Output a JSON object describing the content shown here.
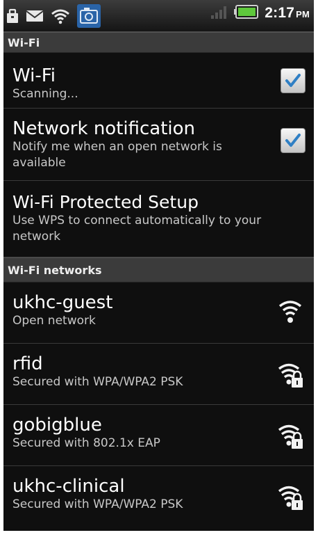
{
  "status_bar": {
    "time": "2:17",
    "ampm": "PM",
    "icons": [
      "briefcase-icon",
      "mail-icon",
      "wifi-signal-icon",
      "camera-icon",
      "cell-signal-icon",
      "battery-icon"
    ]
  },
  "wifi_section": {
    "header": "Wi-Fi",
    "wifi_toggle": {
      "title": "Wi-Fi",
      "subtitle": "Scanning...",
      "checked": true
    },
    "network_notification": {
      "title": "Network notification",
      "subtitle": "Notify me when an open network is available",
      "checked": true
    },
    "wps": {
      "title": "Wi-Fi Protected Setup",
      "subtitle": "Use WPS to connect automatically to your network"
    }
  },
  "networks_section": {
    "header": "Wi-Fi networks",
    "networks": [
      {
        "name": "ukhc-guest",
        "security": "Open network",
        "icon": "wifi-open-icon"
      },
      {
        "name": "rfid",
        "security": "Secured with WPA/WPA2 PSK",
        "icon": "wifi-locked-icon"
      },
      {
        "name": "gobigblue",
        "security": "Secured with 802.1x EAP",
        "icon": "wifi-locked-icon"
      },
      {
        "name": "ukhc-clinical",
        "security": "Secured with WPA/WPA2 PSK",
        "icon": "wifi-locked-icon"
      }
    ]
  },
  "colors": {
    "background": "#0f0f0f",
    "header_bg": "#3b3b3b",
    "check_blue": "#2f7fc4"
  }
}
